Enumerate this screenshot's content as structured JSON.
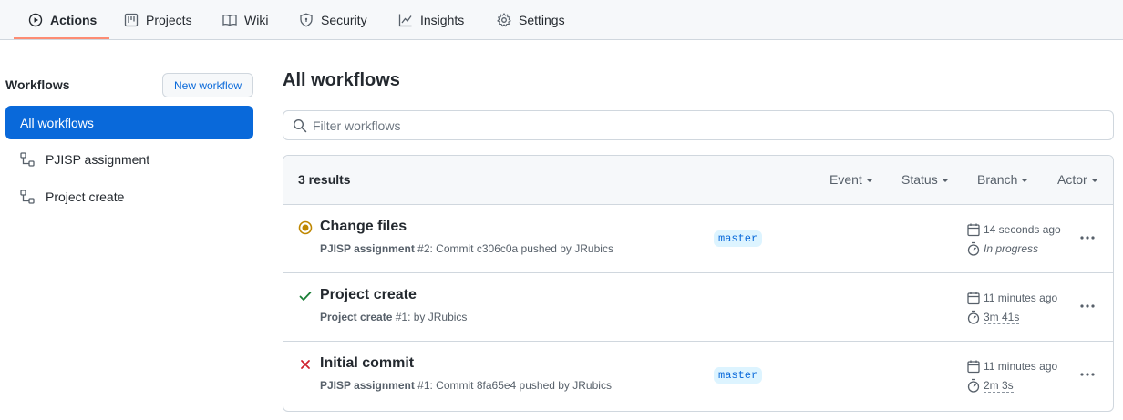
{
  "tabs": [
    {
      "label": "Actions",
      "icon": "play-icon",
      "selected": true
    },
    {
      "label": "Projects",
      "icon": "project-icon"
    },
    {
      "label": "Wiki",
      "icon": "book-icon"
    },
    {
      "label": "Security",
      "icon": "shield-icon"
    },
    {
      "label": "Insights",
      "icon": "graph-icon"
    },
    {
      "label": "Settings",
      "icon": "gear-icon"
    }
  ],
  "sidebar": {
    "title": "Workflows",
    "new_workflow_label": "New workflow",
    "items": [
      {
        "label": "All workflows",
        "active": true
      },
      {
        "label": "PJISP assignment",
        "icon": "workflow-icon"
      },
      {
        "label": "Project create",
        "icon": "workflow-icon"
      }
    ]
  },
  "main": {
    "title": "All workflows",
    "filter_placeholder": "Filter workflows",
    "results_count": "3 results",
    "filters": [
      "Event",
      "Status",
      "Branch",
      "Actor"
    ],
    "runs": [
      {
        "status": "in-progress",
        "status_icon": "in-progress-icon",
        "title": "Change files",
        "workflow": "PJISP assignment",
        "detail": " #2: Commit c306c0a pushed by JRubics",
        "branch": "master",
        "time_ago": "14 seconds ago",
        "duration": "In progress"
      },
      {
        "status": "success",
        "status_icon": "check-icon",
        "title": "Project create",
        "workflow": "Project create",
        "detail": " #1: by JRubics",
        "branch": "",
        "time_ago": "11 minutes ago",
        "duration": "3m 41s"
      },
      {
        "status": "failure",
        "status_icon": "x-icon",
        "title": "Initial commit",
        "workflow": "PJISP assignment",
        "detail": " #1: Commit 8fa65e4 pushed by JRubics",
        "branch": "master",
        "time_ago": "11 minutes ago",
        "duration": "2m 3s"
      }
    ]
  },
  "colors": {
    "accent": "#0969da",
    "tab_underline": "#fd8c73",
    "success": "#1a7f37",
    "failure": "#cf222e",
    "in_progress": "#bf8700"
  }
}
